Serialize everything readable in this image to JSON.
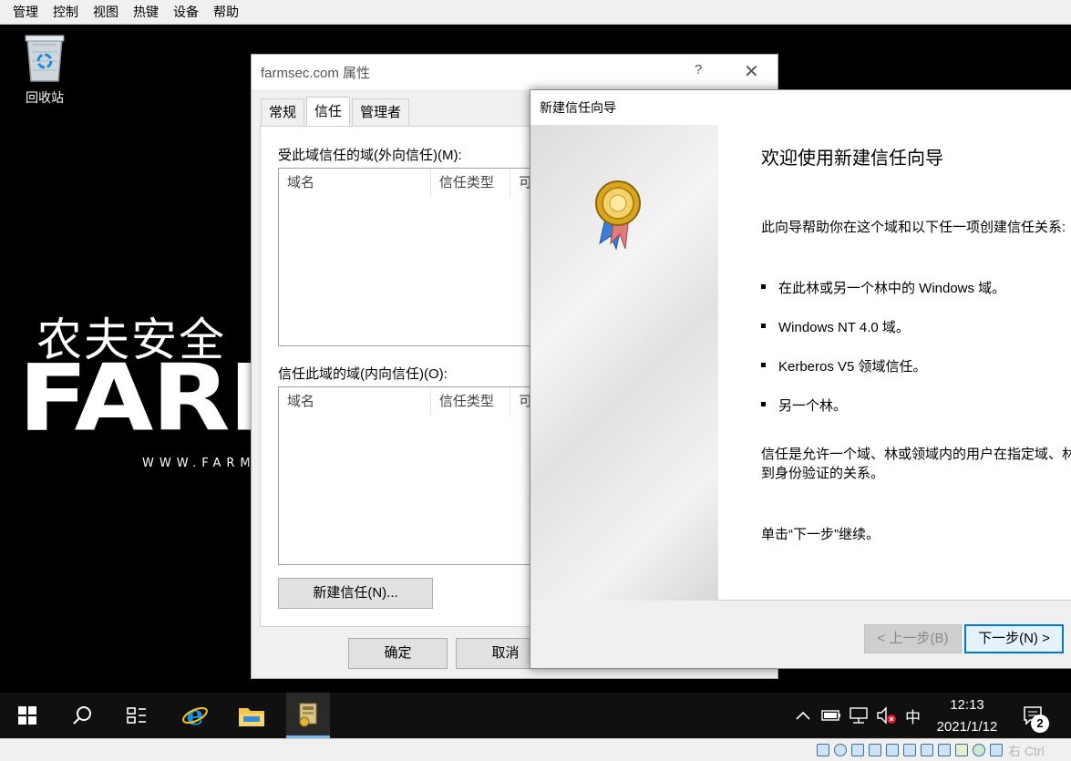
{
  "vm_menu": [
    "管理",
    "控制",
    "视图",
    "热键",
    "设备",
    "帮助"
  ],
  "desktop": {
    "recycle_bin_label": "回收站",
    "logo_cn": "农夫安全",
    "logo_en": "FARM",
    "logo_url": "WWW.FARM"
  },
  "properties": {
    "title": "farmsec.com 属性",
    "help": "?",
    "close": "✕",
    "tabs": [
      "常规",
      "信任",
      "管理者"
    ],
    "active_tab": "信任",
    "outgoing_label": "受此域信任的域(外向信任)(M):",
    "incoming_label": "信任此域的域(内向信任)(O):",
    "columns": [
      "域名",
      "信任类型",
      "可"
    ],
    "new_trust_button": "新建信任(N)...",
    "ok_button": "确定",
    "cancel_button": "取消"
  },
  "wizard": {
    "title": "新建信任向导",
    "heading": "欢迎使用新建信任向导",
    "intro": "此向导帮助你在这个域和以下任一项创建信任关系:",
    "bullets": [
      "在此林或另一个林中的 Windows 域。",
      "Windows NT 4.0 域。",
      "Kerberos V5 领域信任。",
      "另一个林。"
    ],
    "desc_line1": "信任是允许一个域、林或领域内的用户在指定域、林",
    "desc_line2": "到身份验证的关系。",
    "continue_text": "单击“下一步”继续。",
    "back_button": "< 上一步(B)",
    "next_button": "下一步(N) >"
  },
  "taskbar": {
    "clock_time": "12:13",
    "clock_date": "2021/1/12",
    "ime": "中",
    "notifications": "2"
  },
  "vm_status": {
    "host_key": "右 Ctrl"
  },
  "colors": {
    "accent": "#0078d7",
    "taskbar": "#101010",
    "desktop": "#000000"
  }
}
